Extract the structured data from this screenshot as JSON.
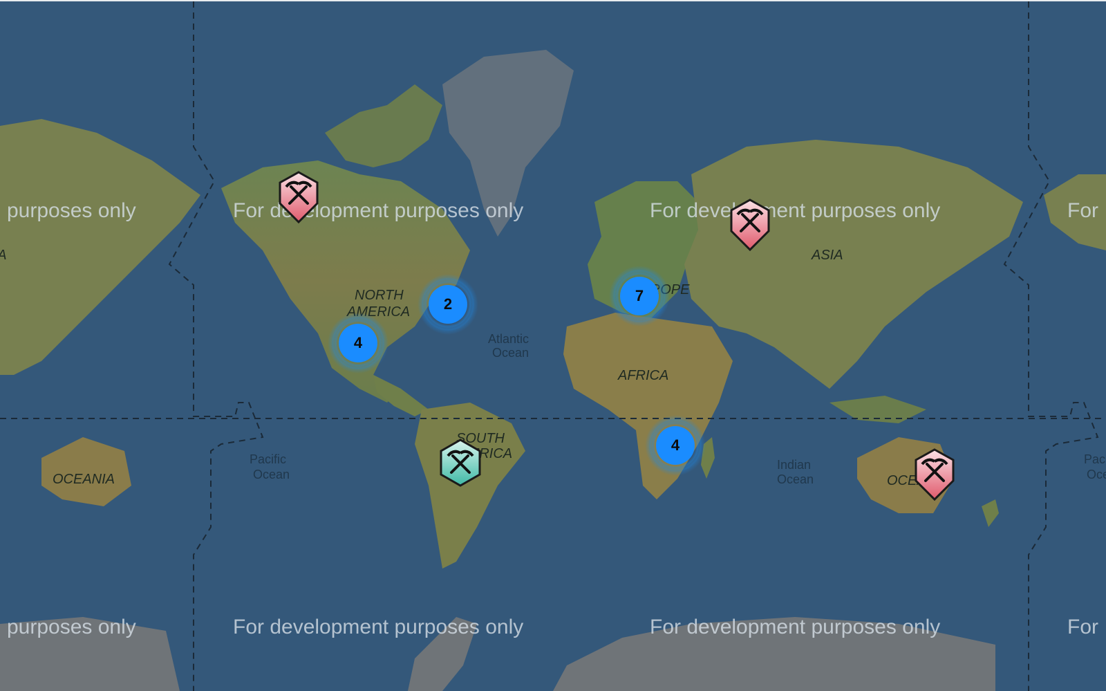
{
  "map": {
    "continent_labels": {
      "north_america_1": "NORTH",
      "north_america_2": "AMERICA",
      "south_america_1": "SOUTH",
      "south_america_2": "AMERICA",
      "europe": "EUROPE",
      "africa": "AFRICA",
      "asia": "ASIA",
      "oceania_left": "OCEANIA",
      "oceania_right": "OCEANIA",
      "asia_left_edge": "ASIA"
    },
    "ocean_labels": {
      "atlantic_1": "Atlantic",
      "atlantic_2": "Ocean",
      "pacific_1": "Pacific",
      "pacific_2": "Ocean",
      "indian_1": "Indian",
      "indian_2": "Ocean",
      "pacific_right_1": "Pacific",
      "pacific_right_2": "Ocean"
    },
    "watermarks": [
      "purposes only",
      "For development purposes only",
      "For development purposes only",
      "For",
      "purposes only",
      "For development purposes only",
      "For development purposes only",
      "For"
    ],
    "clusters": [
      {
        "id": "north-america-east",
        "count": "2"
      },
      {
        "id": "north-america-south",
        "count": "4"
      },
      {
        "id": "europe",
        "count": "7"
      },
      {
        "id": "southern-africa",
        "count": "4"
      }
    ],
    "markers": [
      {
        "id": "alaska",
        "icon": "pickaxes-icon",
        "style": "pin",
        "color": "#e8707e"
      },
      {
        "id": "russia",
        "icon": "pickaxes-icon",
        "style": "pin",
        "color": "#e8707e"
      },
      {
        "id": "australia",
        "icon": "pickaxes-icon",
        "style": "pin",
        "color": "#e8707e"
      },
      {
        "id": "brazil",
        "icon": "pickaxes-icon",
        "style": "hexagon",
        "color": "#3fb9a6"
      }
    ],
    "colors": {
      "ocean": "#34587a",
      "land": "#6f7f4a",
      "ice": "#6d7f89",
      "cluster": "#1a8cff",
      "pin": "#e8707e",
      "hex_marker": "#3fb9a6"
    }
  }
}
